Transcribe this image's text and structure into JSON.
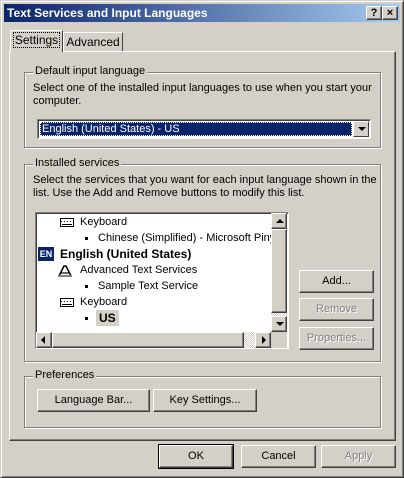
{
  "window": {
    "title": "Text Services and Input Languages",
    "help_label": "?",
    "close_label": "×"
  },
  "tabs": [
    {
      "label": "Settings",
      "active": true
    },
    {
      "label": "Advanced",
      "active": false
    }
  ],
  "default_input_language": {
    "group_label": "Default input language",
    "description": "Select one of the installed input languages to use when you start your computer.",
    "selected": "English (United States) - US"
  },
  "installed_services": {
    "group_label": "Installed services",
    "description": "Select the services that you want for each input language shown in the list. Use the Add and Remove buttons to modify this list.",
    "tree": [
      {
        "text": "Keyboard",
        "icon": "keyboard-icon"
      },
      {
        "text": "Chinese (Simplified) - Microsoft Pinyin",
        "icon": "bullet"
      },
      {
        "text": "English (United States)",
        "icon": "language-en-icon",
        "icon_text": "EN"
      },
      {
        "text": "Advanced Text Services",
        "icon": "text-services-icon"
      },
      {
        "text": "Sample Text Service",
        "icon": "bullet"
      },
      {
        "text": "Keyboard",
        "icon": "keyboard-icon"
      },
      {
        "text": "US",
        "icon": "bullet",
        "selected": true
      }
    ],
    "buttons": {
      "add": "Add...",
      "remove": "Remove",
      "properties": "Properties..."
    }
  },
  "preferences": {
    "group_label": "Preferences",
    "language_bar": "Language Bar...",
    "key_settings": "Key Settings..."
  },
  "footer": {
    "ok": "OK",
    "cancel": "Cancel",
    "apply": "Apply"
  }
}
